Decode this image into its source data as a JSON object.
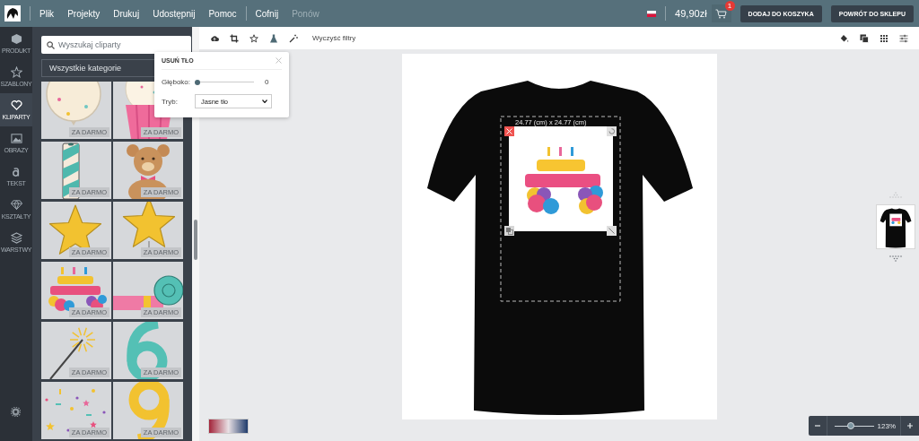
{
  "topbar": {
    "menu": [
      "Plik",
      "Projekty",
      "Drukuj",
      "Udostępnij",
      "Pomoc"
    ],
    "history": [
      {
        "label": "Cofnij",
        "disabled": false
      },
      {
        "label": "Ponów",
        "disabled": true
      }
    ],
    "price": "49,90zł",
    "cart_badge": "1",
    "buttons": [
      "DODAJ DO KOSZYKA",
      "POWRÓT DO SKLEPU"
    ]
  },
  "sidebar": {
    "items": [
      {
        "label": "PRODUKT",
        "kind": "cube",
        "selected": false
      },
      {
        "label": "SZABLONY",
        "kind": "star",
        "selected": false
      },
      {
        "label": "KLIPARTY",
        "kind": "heart",
        "selected": true
      },
      {
        "label": "OBRAZY",
        "kind": "image",
        "selected": false
      },
      {
        "label": "TEKST",
        "kind": "text",
        "selected": false
      },
      {
        "label": "KSZTAŁTY",
        "kind": "diamond",
        "selected": false
      },
      {
        "label": "WARSTWY",
        "kind": "layers",
        "selected": false
      }
    ]
  },
  "clipart_panel": {
    "search": {
      "placeholder": "Wyszukaj cliparty"
    },
    "category": "Wszystkie kategorie",
    "items": [
      {
        "kind": "balloon",
        "badge": "ZA DARMO"
      },
      {
        "kind": "cupcake",
        "badge": "ZA DARMO"
      },
      {
        "kind": "candle",
        "badge": "ZA DARMO"
      },
      {
        "kind": "bear",
        "badge": "ZA DARMO"
      },
      {
        "kind": "star",
        "badge": "ZA DARMO"
      },
      {
        "kind": "star-balloon",
        "badge": "ZA DARMO"
      },
      {
        "kind": "birthday",
        "badge": "ZA DARMO"
      },
      {
        "kind": "party-horn",
        "badge": "ZA DARMO"
      },
      {
        "kind": "sparkler",
        "badge": "ZA DARMO"
      },
      {
        "kind": "six",
        "badge": "ZA DARMO"
      },
      {
        "kind": "confetti",
        "badge": "ZA DARMO"
      },
      {
        "kind": "nine",
        "badge": "ZA DARMO"
      }
    ]
  },
  "toolbar": {
    "clear_filters": "Wyczyść filtry"
  },
  "remove_background_popup": {
    "title": "USUŃ TŁO",
    "depth": {
      "label": "Głęboko:",
      "level": 0,
      "reading": "0"
    },
    "mode": {
      "label": "Tryb:",
      "value": "Jasne tło"
    }
  },
  "design": {
    "dimensions": "24.77 (cm) x 24.77 (cm)"
  },
  "zoom": {
    "level": 0.4,
    "reading": "123%"
  }
}
